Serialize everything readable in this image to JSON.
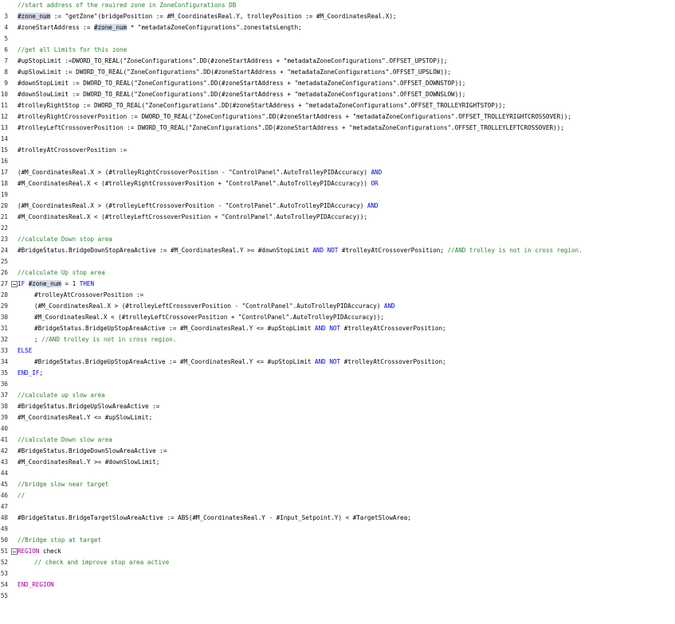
{
  "editor": {
    "lines": {
      "l3": {
        "n": "3",
        "comment": "//start address of the reuired zone in ZoneConfigurations DB"
      },
      "l4": {
        "n": "4",
        "var": "#zone_num",
        "rest": " := \"getZone\"(bridgePosition := #M_CoordinatesReal.Y, trolleyPosition := #M_CoordinatesReal.X);"
      },
      "l5": {
        "n": "5",
        "pre": "#zoneStartAddress := ",
        "var": "#zone_num",
        "rest": " * \"metadataZoneConfigurations\".zonestatsLength;"
      },
      "l6": {
        "n": "6"
      },
      "l7": {
        "n": "7",
        "comment": "//get all Limits for this zone"
      },
      "l8": {
        "n": "8",
        "text": "#upStopLimit :=DWORD_TO_REAL(\"ZoneConfigurations\".DD(#zoneStartAddress + \"metadataZoneConfigurations\".OFFSET_UPSTOP));"
      },
      "l9": {
        "n": "9",
        "text": "#upSlowLimit := DWORD_TO_REAL(\"ZoneConfigurations\".DD(#zoneStartAddress + \"metadataZoneConfigurations\".OFFSET_UPSLOW));"
      },
      "l10": {
        "n": "10",
        "text": "#downStopLimit := DWORD_TO_REAL(\"ZoneConfigurations\".DD(#zoneStartAddress + \"metadataZoneConfigurations\".OFFSET_DOWNSTOP));"
      },
      "l11": {
        "n": "11",
        "text": "#downSlowLimit := DWORD_TO_REAL(\"ZoneConfigurations\".DD(#zoneStartAddress + \"metadataZoneConfigurations\".OFFSET_DOWNSLOW));"
      },
      "l12": {
        "n": "12",
        "text": "#trolleyRightStop := DWORD_TO_REAL(\"ZoneConfigurations\".DD(#zoneStartAddress + \"metadataZoneConfigurations\".OFFSET_TROLLEYRIGHTSTOP));"
      },
      "l13": {
        "n": "13",
        "text": "#trolleyRightCrossoverPosition := DWORD_TO_REAL(\"ZoneConfigurations\".DD(#zoneStartAddress + \"metadataZoneConfigurations\".OFFSET_TROLLEYRIGHTCROSSOVER));"
      },
      "l14": {
        "n": "14",
        "text": "#trolleyLeftCrossoverPosition := DWORD_TO_REAL(\"ZoneConfigurations\".DD(#zoneStartAddress + \"metadataZoneConfigurations\".OFFSET_TROLLEYLEFTCROSSOVER));"
      },
      "l15": {
        "n": "15"
      },
      "l16": {
        "n": "16",
        "text": "#trolleyAtCrossoverPosition :="
      },
      "l17": {
        "n": "17"
      },
      "l18": {
        "n": "18",
        "text": "(#M_CoordinatesReal.X > (#trolleyRightCrossoverPosition - \"ControlPanel\".AutoTrolleyPIDAccuracy) ",
        "kw": "AND"
      },
      "l19": {
        "n": "19",
        "text": "#M_CoordinatesReal.X < (#trolleyRightCrossoverPosition + \"ControlPanel\".AutoTrolleyPIDAccuracy)) ",
        "kw": "OR"
      },
      "l20": {
        "n": "20"
      },
      "l21": {
        "n": "21",
        "text": "(#M_CoordinatesReal.X > (#trolleyLeftCrossoverPosition - \"ControlPanel\".AutoTrolleyPIDAccuracy) ",
        "kw": "AND"
      },
      "l22": {
        "n": "22",
        "text": "#M_CoordinatesReal.X < (#trolleyLeftCrossoverPosition + \"ControlPanel\".AutoTrolleyPIDAccuracy));"
      },
      "l23": {
        "n": "23"
      },
      "l24": {
        "n": "24",
        "comment": "//calculate Down stop area"
      },
      "l25": {
        "n": "25",
        "a": "#BridgeStatus.BridgeDownStopAreaActive := #M_CoordinatesReal.Y >= #downStopLimit ",
        "kw1": "AND",
        "sp": " ",
        "kw2": "NOT",
        "b": " #trolleyAtCrossoverPosition; ",
        "comment": "//AND trolley is not in cross region."
      },
      "l26": {
        "n": "26"
      },
      "l27": {
        "n": "27",
        "comment": "//calculate Up stop area"
      },
      "l28": {
        "n": "28",
        "kw1": "IF",
        "sp1": " ",
        "var": "#zone_num",
        "mid": " = 1 ",
        "kw2": "THEN"
      },
      "l29": {
        "n": "29",
        "text": "#trolleyAtCrossoverPosition :="
      },
      "l30": {
        "n": "30",
        "text": "(#M_CoordinatesReal.X > (#trolleyLeftCrossoverPosition - \"ControlPanel\".AutoTrolleyPIDAccuracy) ",
        "kw": "AND"
      },
      "l31": {
        "n": "31",
        "text": "#M_CoordinatesReal.X < (#trolleyLeftCrossoverPosition + \"ControlPanel\".AutoTrolleyPIDAccuracy));"
      },
      "l32": {
        "n": "32",
        "a": "#BridgeStatus.BridgeUpStopAreaActive := #M_CoordinatesReal.Y <= #upStopLimit ",
        "kw1": "AND",
        "sp": " ",
        "kw2": "NOT",
        "b": " #trolleyAtCrossoverPosition;"
      },
      "l33": {
        "n": "33",
        "pre": "; ",
        "comment": "//AND trolley is not in cross region."
      },
      "l34": {
        "n": "34",
        "kw": "ELSE"
      },
      "l35": {
        "n": "35",
        "a": "#BridgeStatus.BridgeUpStopAreaActive := #M_CoordinatesReal.Y <= #upStopLimit ",
        "kw1": "AND",
        "sp": " ",
        "kw2": "NOT",
        "b": " #trolleyAtCrossoverPosition;"
      },
      "l36": {
        "n": "36",
        "kw": "END_IF",
        "rest": ";"
      },
      "l37": {
        "n": "37"
      },
      "l38": {
        "n": "38",
        "comment": "//calculate up slow area"
      },
      "l39": {
        "n": "39",
        "text": "#BridgeStatus.BridgeUpSlowAreaActive :="
      },
      "l40": {
        "n": "40",
        "text": "#M_CoordinatesReal.Y <= #upSlowLimit;"
      },
      "l41": {
        "n": "41"
      },
      "l42": {
        "n": "42",
        "comment": "//calculate Down slow area"
      },
      "l43": {
        "n": "43",
        "text": "#BridgeStatus.BridgeDownSlowAreaActive :="
      },
      "l44": {
        "n": "44",
        "text": "#M_CoordinatesReal.Y >= #downSlowLimit;"
      },
      "l45": {
        "n": "45"
      },
      "l46": {
        "n": "46",
        "comment": "//bridge slow near target"
      },
      "l47": {
        "n": "47",
        "comment": "//"
      },
      "l48": {
        "n": "48"
      },
      "l49": {
        "n": "49",
        "text": "#BridgeStatus.BridgeTargetSlowAreaActive := ABS(#M_CoordinatesReal.Y - #Input_Setpoint.Y) < #TargetSlowArea;"
      },
      "l50": {
        "n": "50"
      },
      "l51": {
        "n": "51",
        "comment": "//Bridge stop at target"
      },
      "l52": {
        "n": "52",
        "kw": "REGION",
        "rest": " check"
      },
      "l53": {
        "n": "53",
        "comment": "// check and improve stop area active"
      },
      "l54": {
        "n": "54"
      },
      "l55": {
        "n": "55",
        "kw": "END_REGION"
      }
    }
  }
}
